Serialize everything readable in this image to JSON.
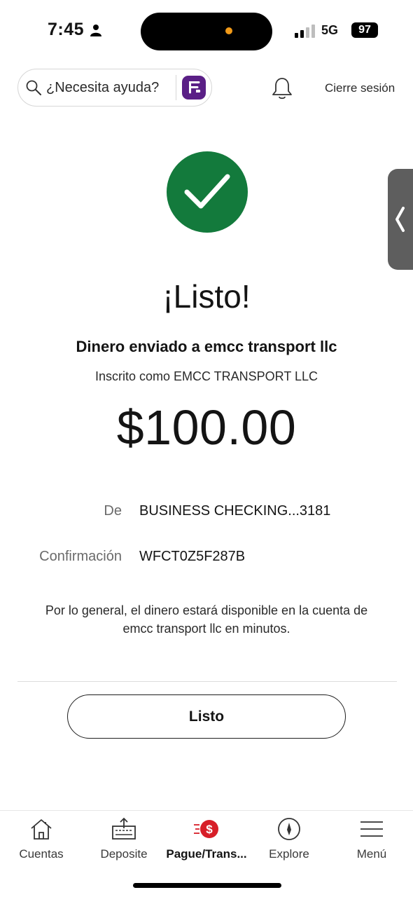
{
  "status_bar": {
    "time": "7:45",
    "network": "5G",
    "battery": "97"
  },
  "header": {
    "search_label": "¿Necesita ayuda?",
    "signout_label": "Cierre sesión"
  },
  "confirmation": {
    "headline": "¡Listo!",
    "sent_to": "Dinero enviado a emcc transport llc",
    "enrolled_as": "Inscrito como EMCC TRANSPORT LLC",
    "amount": "$100.00",
    "from_label": "De",
    "from_value": "BUSINESS CHECKING...3181",
    "confirmation_label": "Confirmación",
    "confirmation_value": "WFCT0Z5F287B",
    "notice": "Por lo general, el dinero estará disponible en la cuenta de emcc transport llc en minutos.",
    "done_button": "Listo"
  },
  "bottom_nav": {
    "items": [
      {
        "label": "Cuentas",
        "icon": "home-icon"
      },
      {
        "label": "Deposite",
        "icon": "deposit-icon"
      },
      {
        "label": "Pague/Trans...",
        "icon": "pay-transfer-icon"
      },
      {
        "label": "Explore",
        "icon": "compass-icon"
      },
      {
        "label": "Menú",
        "icon": "menu-icon"
      }
    ],
    "active_index": 2
  },
  "colors": {
    "success_green": "#137a3c",
    "brand_red": "#d71e28",
    "fargo_purple": "#5a1f86"
  }
}
